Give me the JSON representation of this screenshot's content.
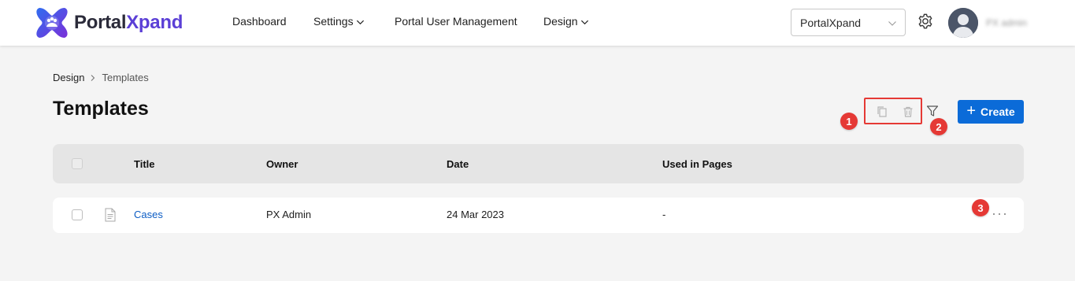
{
  "brand": {
    "name_part1": "Portal",
    "name_part2": "Xpand",
    "color_part2": "#5b3fd6"
  },
  "nav": {
    "items": [
      {
        "label": "Dashboard"
      },
      {
        "label": "Settings"
      },
      {
        "label": "Portal User Management"
      },
      {
        "label": "Design"
      }
    ]
  },
  "portal_select": {
    "value": "PortalXpand"
  },
  "user": {
    "name": "PX admin"
  },
  "breadcrumb": {
    "parent": "Design",
    "current": "Templates"
  },
  "page": {
    "title": "Templates"
  },
  "toolbar": {
    "create_label": "Create",
    "markers": [
      "1",
      "2",
      "3"
    ]
  },
  "table": {
    "columns": [
      "Title",
      "Owner",
      "Date",
      "Used in Pages"
    ],
    "rows": [
      {
        "title": "Cases",
        "owner": "PX Admin",
        "date": "24 Mar 2023",
        "used_in_pages": "-"
      }
    ]
  },
  "colors": {
    "accent": "#0b6bd8",
    "highlight": "#e53935",
    "link": "#0b5cc4"
  }
}
